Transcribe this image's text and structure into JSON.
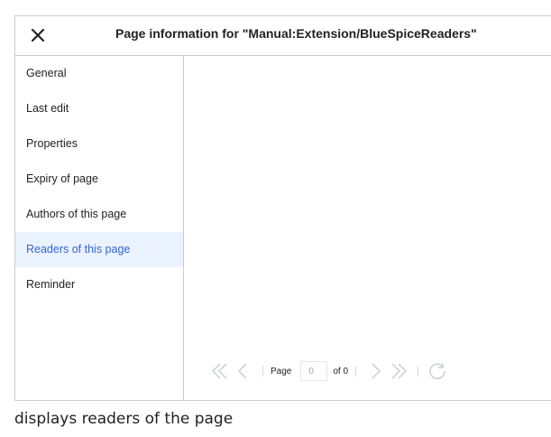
{
  "dialog": {
    "title": "Page information for \"Manual:Extension/BlueSpiceReaders\"",
    "close_icon": "close-icon"
  },
  "sidebar": {
    "items": [
      {
        "label": "General",
        "active": false
      },
      {
        "label": "Last edit",
        "active": false
      },
      {
        "label": "Properties",
        "active": false
      },
      {
        "label": "Expiry of page",
        "active": false
      },
      {
        "label": "Authors of this page",
        "active": false
      },
      {
        "label": "Readers of this page",
        "active": true
      },
      {
        "label": "Reminder",
        "active": false
      }
    ]
  },
  "pager": {
    "page_label": "Page",
    "page_value": "0",
    "of_label": "of 0",
    "icons": [
      "first-page-icon",
      "previous-page-icon",
      "next-page-icon",
      "last-page-icon",
      "refresh-icon"
    ]
  },
  "caption": "displays readers of the page",
  "colors": {
    "active_bg": "#eaf3ff",
    "active_text": "#3366cc",
    "border": "#c8ccd1",
    "pager_icon": "#c8ccd1"
  }
}
